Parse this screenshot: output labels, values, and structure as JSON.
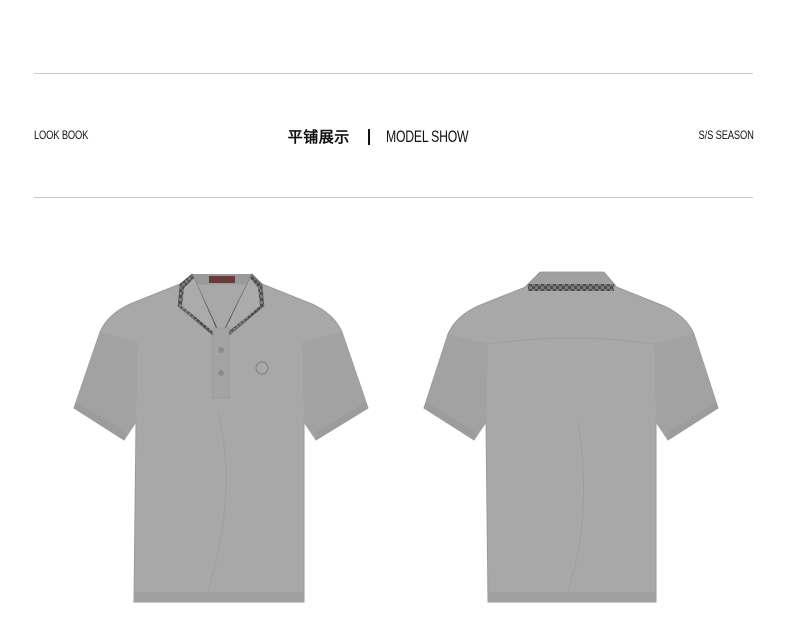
{
  "header": {
    "left_label": "LOOK BOOK",
    "title_cn": "平铺展示",
    "title_en": "MODEL SHOW",
    "right_label": "S/S SEASON"
  },
  "colors": {
    "shirt": "#a9a9a9",
    "collar_trim": "#6e6e6e",
    "rule": "#c9c9c9"
  },
  "products": [
    {
      "view": "front",
      "icon": "polo-shirt-front-icon"
    },
    {
      "view": "back",
      "icon": "polo-shirt-back-icon"
    }
  ]
}
